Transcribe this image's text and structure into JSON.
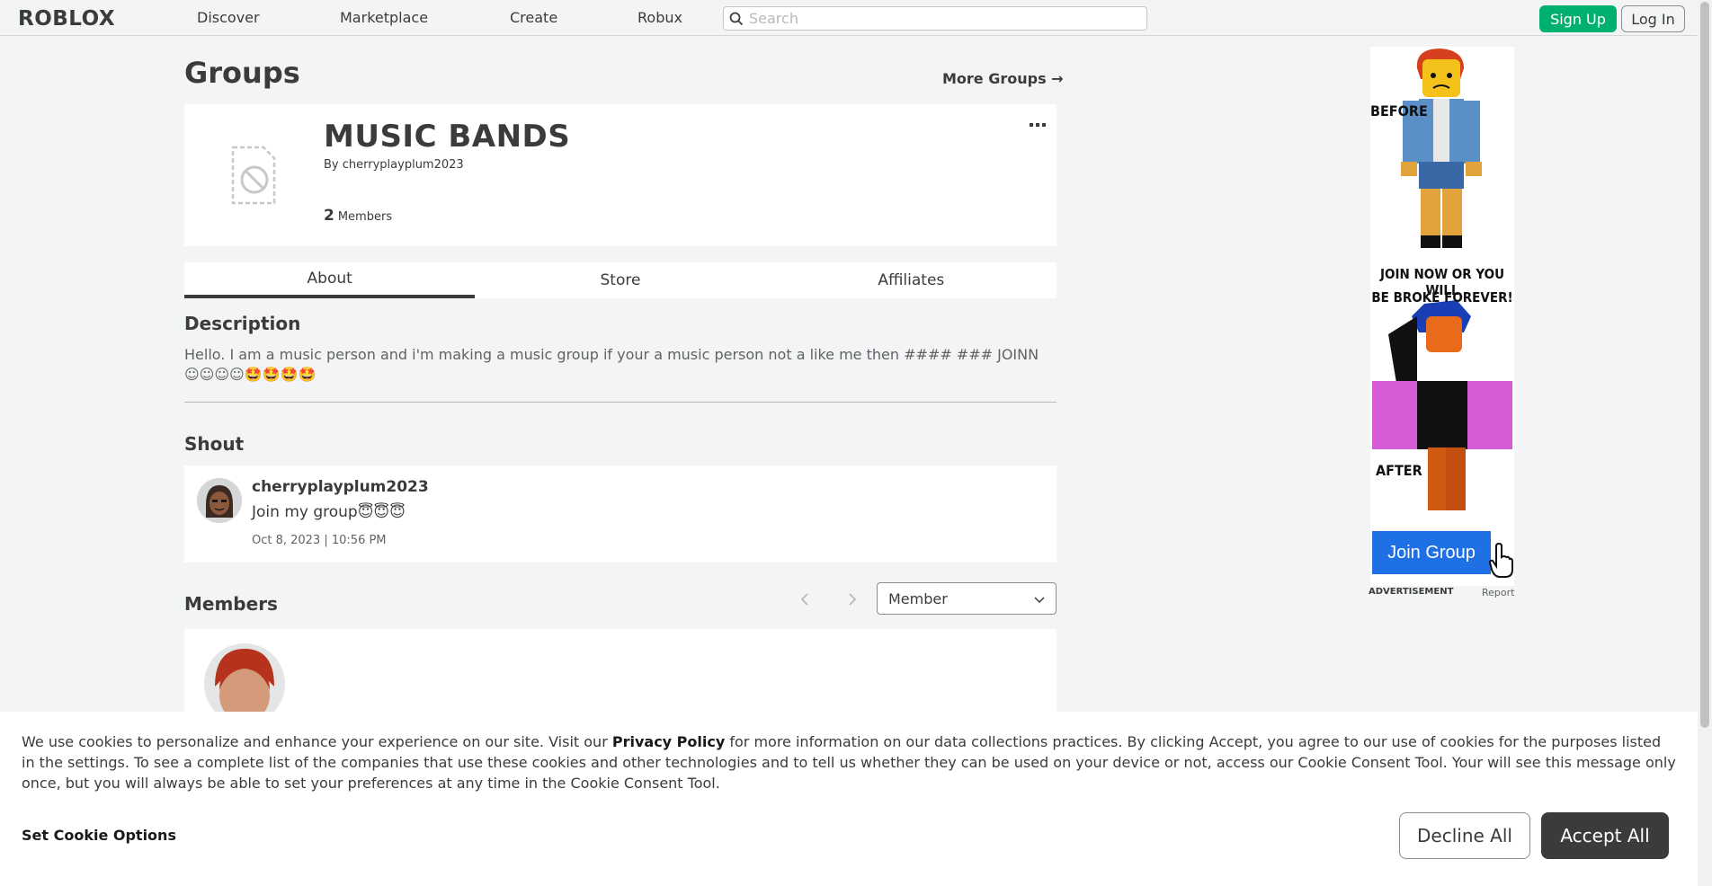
{
  "header": {
    "logo": "ROBLOX",
    "nav": [
      "Discover",
      "Marketplace",
      "Create",
      "Robux"
    ],
    "search_placeholder": "Search",
    "signup_label": "Sign Up",
    "login_label": "Log In"
  },
  "page": {
    "title": "Groups",
    "more_groups": "More Groups →"
  },
  "group": {
    "name": "MUSIC BANDS",
    "by_prefix": "By",
    "owner": "cherryplayplum2023",
    "member_count": "2",
    "members_label": "Members",
    "more_menu": "…"
  },
  "tabs": [
    "About",
    "Store",
    "Affiliates"
  ],
  "description": {
    "heading": "Description",
    "text": "Hello. I am a music person and i'm making a music group if your a music person not a like me then #### ### JOINN ☺☺☺☺🤩🤩🤩🤩"
  },
  "shout": {
    "heading": "Shout",
    "user": "cherryplayplum2023",
    "message": "Join my group😇😇😇",
    "date": "Oct 8, 2023 | 10:56 PM"
  },
  "members": {
    "heading": "Members",
    "prev": "‹",
    "next": "›",
    "role_selected": "Member"
  },
  "ad": {
    "before": "BEFORE",
    "tagline_1": "JOIN NOW OR YOU WILL",
    "tagline_2": "BE BROKE FOREVER!",
    "after": "AFTER",
    "join": "Join Group",
    "label": "ADVERTISEMENT",
    "report": "Report"
  },
  "cookie": {
    "text_1": "We use cookies to personalize and enhance your experience on our site. Visit our ",
    "privacy_link": "Privacy Policy",
    "text_2": " for more information on our data collections practices. By clicking Accept, you agree to our use of cookies for the purposes listed in the settings. To see a complete list of the companies that use these cookies and other technologies and to tell us whether they can be used on your device or not, access our Cookie Consent Tool. Your will see this message only once, but you will always be able to set your preferences at any time in the Cookie Consent Tool.",
    "options_label": "Set Cookie Options",
    "decline_label": "Decline All",
    "accept_label": "Accept All"
  },
  "colors": {
    "signup_green": "#00b06f",
    "accept_dark": "#393b3d",
    "join_blue": "#1f6fe5"
  }
}
